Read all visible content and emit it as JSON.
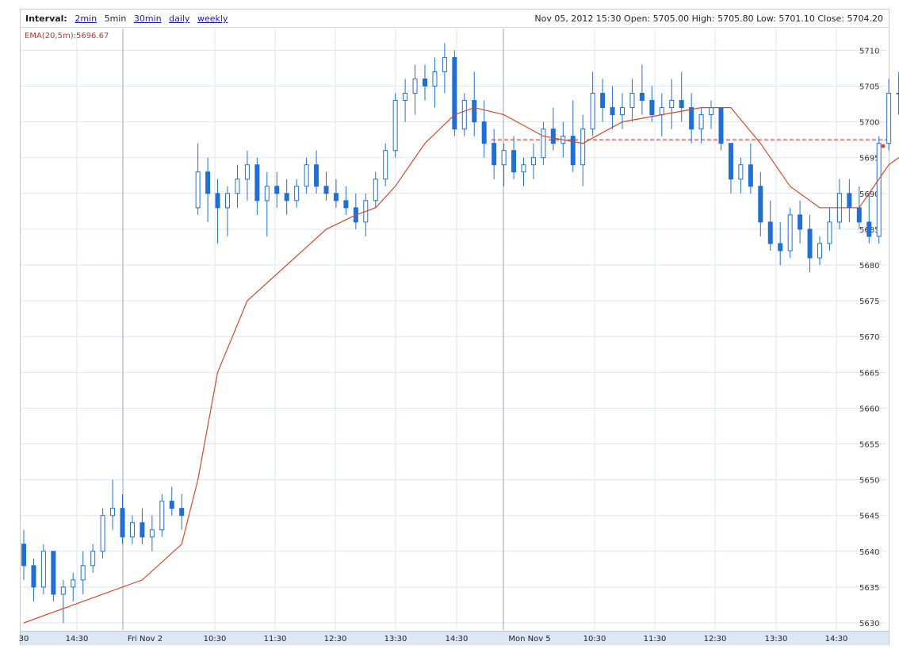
{
  "header": {
    "interval_label": "Interval:",
    "intervals": [
      {
        "label": "2min",
        "active": false
      },
      {
        "label": "5min",
        "active": true
      },
      {
        "label": "30min",
        "active": false
      },
      {
        "label": "daily",
        "active": false
      },
      {
        "label": "weekly",
        "active": false
      }
    ],
    "ohlc_text": "Nov 05, 2012 15:30 Open: 5705.00 High: 5705.80 Low: 5701.10 Close: 5704.20"
  },
  "ema_label": "EMA(20,5m):5696.67",
  "colors": {
    "candle": "#1f6fd6",
    "ema": "#d24a2a",
    "reference_line": "#b22222",
    "grid": "#dde3ef",
    "axis_bar": "#dde6f4"
  },
  "chart_data": {
    "type": "candlestick",
    "ylim": [
      5628,
      5714
    ],
    "y_ticks": [
      5630,
      5635,
      5640,
      5645,
      5650,
      5655,
      5660,
      5665,
      5670,
      5675,
      5680,
      5685,
      5690,
      5695,
      5700,
      5705,
      5710
    ],
    "x_ticks": [
      "30",
      "14:30",
      "Fri Nov 2",
      "10:30",
      "11:30",
      "12:30",
      "13:30",
      "14:30",
      "Mon Nov 5",
      "10:30",
      "11:30",
      "12:30",
      "13:30",
      "14:30"
    ],
    "reference_line": 5697.5,
    "candles": [
      [
        5641,
        5643,
        5636,
        5638
      ],
      [
        5638,
        5639,
        5633,
        5635
      ],
      [
        5635,
        5641,
        5634,
        5640
      ],
      [
        5640,
        5640,
        5633,
        5634
      ],
      [
        5634,
        5636,
        5630,
        5635
      ],
      [
        5635,
        5637,
        5633,
        5636
      ],
      [
        5636,
        5640,
        5634,
        5638
      ],
      [
        5638,
        5641,
        5637,
        5640
      ],
      [
        5640,
        5646,
        5639,
        5645
      ],
      [
        5645,
        5650,
        5643,
        5646
      ],
      [
        5646,
        5648,
        5641,
        5642
      ],
      [
        5642,
        5645,
        5641,
        5644
      ],
      [
        5644,
        5646,
        5641,
        5642
      ],
      [
        5642,
        5645,
        5640,
        5643
      ],
      [
        5643,
        5648,
        5642,
        5647
      ],
      [
        5647,
        5649,
        5645,
        5646
      ],
      [
        5646,
        5648,
        5643,
        5645
      ],
      [
        5688,
        5697,
        5687,
        5693
      ],
      [
        5693,
        5695,
        5686,
        5690
      ],
      [
        5690,
        5692,
        5683,
        5688
      ],
      [
        5688,
        5691,
        5684,
        5690
      ],
      [
        5690,
        5694,
        5688,
        5692
      ],
      [
        5692,
        5696,
        5689,
        5694
      ],
      [
        5694,
        5695,
        5687,
        5689
      ],
      [
        5689,
        5693,
        5684,
        5691
      ],
      [
        5691,
        5693,
        5688,
        5690
      ],
      [
        5690,
        5692,
        5687,
        5689
      ],
      [
        5689,
        5692,
        5688,
        5691
      ],
      [
        5691,
        5695,
        5690,
        5694
      ],
      [
        5694,
        5696,
        5690,
        5691
      ],
      [
        5691,
        5693,
        5689,
        5690
      ],
      [
        5690,
        5692,
        5688,
        5689
      ],
      [
        5689,
        5691,
        5687,
        5688
      ],
      [
        5688,
        5690,
        5685,
        5686
      ],
      [
        5686,
        5690,
        5684,
        5689
      ],
      [
        5689,
        5693,
        5688,
        5692
      ],
      [
        5692,
        5697,
        5691,
        5696
      ],
      [
        5696,
        5704,
        5695,
        5703
      ],
      [
        5703,
        5706,
        5700,
        5704
      ],
      [
        5704,
        5708,
        5701,
        5706
      ],
      [
        5706,
        5708,
        5703,
        5705
      ],
      [
        5705,
        5709,
        5702,
        5707
      ],
      [
        5707,
        5711,
        5704,
        5709
      ],
      [
        5709,
        5710,
        5698,
        5699
      ],
      [
        5699,
        5704,
        5698,
        5703
      ],
      [
        5703,
        5707,
        5698,
        5700
      ],
      [
        5700,
        5703,
        5695,
        5697
      ],
      [
        5697,
        5699,
        5692,
        5694
      ],
      [
        5694,
        5697,
        5691,
        5696
      ],
      [
        5696,
        5698,
        5692,
        5693
      ],
      [
        5693,
        5695,
        5691,
        5694
      ],
      [
        5694,
        5697,
        5692,
        5695
      ],
      [
        5695,
        5700,
        5694,
        5699
      ],
      [
        5699,
        5702,
        5696,
        5697
      ],
      [
        5697,
        5700,
        5695,
        5698
      ],
      [
        5698,
        5703,
        5693,
        5694
      ],
      [
        5694,
        5701,
        5691,
        5699
      ],
      [
        5699,
        5707,
        5698,
        5704
      ],
      [
        5704,
        5706,
        5700,
        5702
      ],
      [
        5702,
        5705,
        5699,
        5701
      ],
      [
        5701,
        5704,
        5699,
        5702
      ],
      [
        5702,
        5706,
        5700,
        5704
      ],
      [
        5704,
        5708,
        5701,
        5703
      ],
      [
        5703,
        5705,
        5700,
        5701
      ],
      [
        5701,
        5704,
        5698,
        5702
      ],
      [
        5702,
        5706,
        5699,
        5703
      ],
      [
        5703,
        5707,
        5700,
        5702
      ],
      [
        5702,
        5704,
        5697,
        5699
      ],
      [
        5699,
        5702,
        5697,
        5701
      ],
      [
        5701,
        5703,
        5699,
        5702
      ],
      [
        5702,
        5702,
        5696,
        5697
      ],
      [
        5697,
        5696,
        5690,
        5692
      ],
      [
        5692,
        5695,
        5690,
        5694
      ],
      [
        5694,
        5697,
        5690,
        5691
      ],
      [
        5691,
        5693,
        5684,
        5686
      ],
      [
        5686,
        5689,
        5682,
        5683
      ],
      [
        5683,
        5686,
        5680,
        5682
      ],
      [
        5682,
        5688,
        5681,
        5687
      ],
      [
        5687,
        5689,
        5683,
        5685
      ],
      [
        5685,
        5687,
        5679,
        5681
      ],
      [
        5681,
        5684,
        5680,
        5683
      ],
      [
        5683,
        5688,
        5682,
        5686
      ],
      [
        5686,
        5692,
        5685,
        5690
      ],
      [
        5690,
        5692,
        5686,
        5688
      ],
      [
        5688,
        5691,
        5685,
        5686
      ],
      [
        5686,
        5690,
        5683,
        5684
      ],
      [
        5684,
        5698,
        5683,
        5697
      ],
      [
        5697,
        5706,
        5696,
        5704
      ],
      [
        5704,
        5707,
        5701,
        5704
      ]
    ],
    "ema": [
      [
        0,
        5630
      ],
      [
        6,
        5633
      ],
      [
        12,
        5636
      ],
      [
        16,
        5641
      ],
      [
        17,
        5650
      ],
      [
        19,
        5665
      ],
      [
        22,
        5675
      ],
      [
        26,
        5680
      ],
      [
        30,
        5685
      ],
      [
        33,
        5687
      ],
      [
        35,
        5688
      ],
      [
        37,
        5691
      ],
      [
        40,
        5697
      ],
      [
        43,
        5701
      ],
      [
        45,
        5702
      ],
      [
        48,
        5701
      ],
      [
        52,
        5698
      ],
      [
        56,
        5697
      ],
      [
        60,
        5700
      ],
      [
        64,
        5701
      ],
      [
        68,
        5702
      ],
      [
        71,
        5702
      ],
      [
        74,
        5697
      ],
      [
        77,
        5691
      ],
      [
        80,
        5688
      ],
      [
        84,
        5688
      ],
      [
        87,
        5694
      ],
      [
        90,
        5697
      ]
    ]
  }
}
